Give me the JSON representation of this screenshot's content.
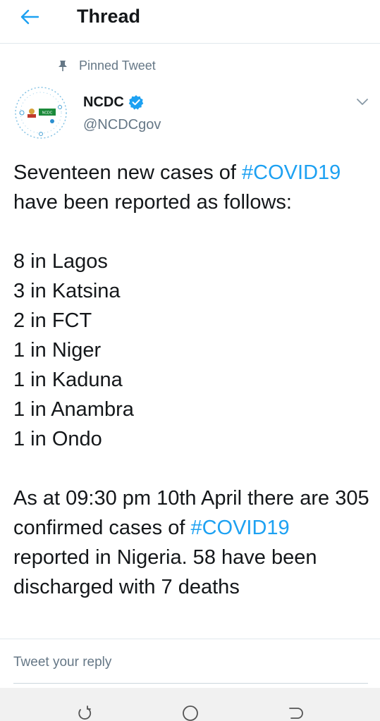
{
  "header": {
    "back_icon": "arrow-left-icon",
    "title": "Thread"
  },
  "pinned": {
    "icon": "pin-icon",
    "label": "Pinned Tweet"
  },
  "author": {
    "name": "NCDC",
    "handle": "@NCDCgov",
    "verified": true,
    "avatar_icon": "ncdc-logo",
    "avatar_text": "NCDC"
  },
  "tweet": {
    "intro_prefix": "Seventeen new cases of ",
    "hashtag1": "#COVID19",
    "intro_suffix": " have been reported as follows:",
    "lines": [
      "8 in Lagos",
      "3 in Katsina",
      "2 in FCT",
      "1 in Niger",
      "1 in Kaduna",
      "1 in Anambra",
      "1 in Ondo"
    ],
    "summary_prefix": "As at 09:30 pm 10th April there are 305 confirmed cases of ",
    "hashtag2": "#COVID19",
    "summary_suffix": " reported in Nigeria. 58 have been discharged with 7 deaths"
  },
  "reply": {
    "placeholder": "Tweet your reply"
  },
  "colors": {
    "accent": "#1da1f2",
    "secondary_text": "#657786",
    "primary_text": "#14171a"
  },
  "navbar": {
    "recent_icon": "recent-apps-icon",
    "home_icon": "home-circle-icon",
    "back_icon": "back-icon"
  }
}
